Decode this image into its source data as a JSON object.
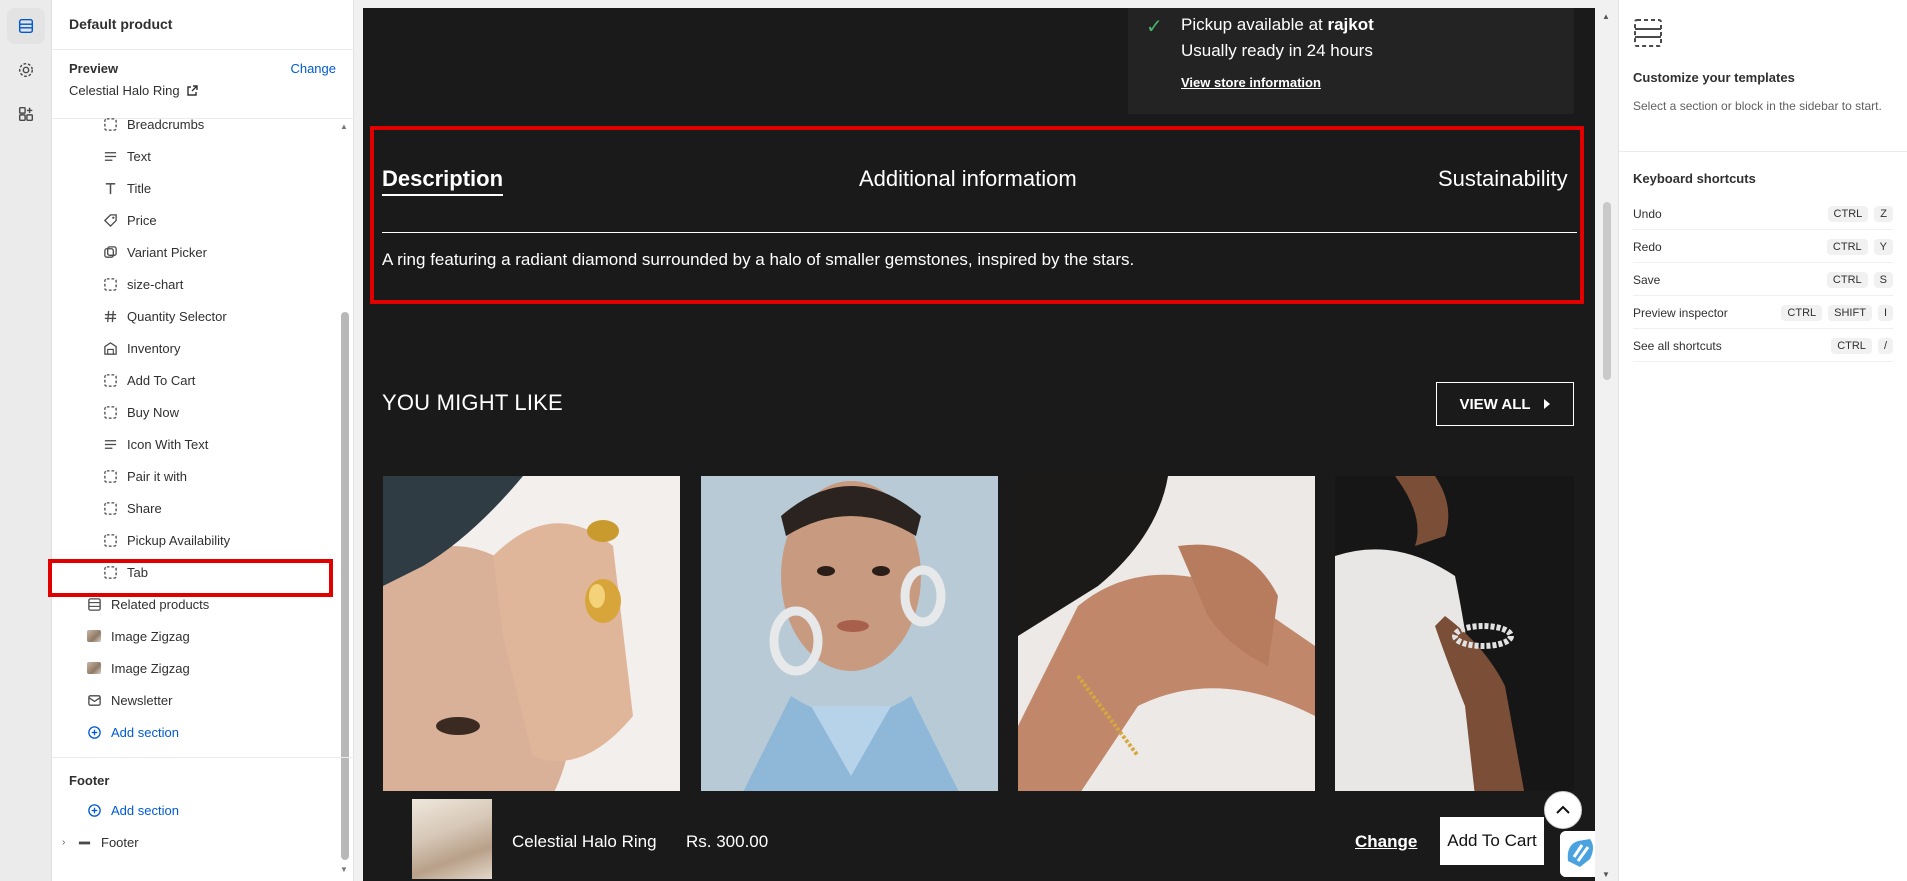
{
  "sidebar": {
    "title": "Default product",
    "preview_label": "Preview",
    "preview_change": "Change",
    "preview_product": "Celestial Halo Ring",
    "items": [
      {
        "label": "Breadcrumbs",
        "icon": "dashed-block-icon"
      },
      {
        "label": "Text",
        "icon": "text-lines-icon"
      },
      {
        "label": "Title",
        "icon": "title-t-icon"
      },
      {
        "label": "Price",
        "icon": "price-tag-icon"
      },
      {
        "label": "Variant Picker",
        "icon": "variant-picker-icon"
      },
      {
        "label": "size-chart",
        "icon": "dashed-block-icon"
      },
      {
        "label": "Quantity Selector",
        "icon": "hash-icon"
      },
      {
        "label": "Inventory",
        "icon": "inventory-icon"
      },
      {
        "label": "Add To Cart",
        "icon": "dashed-block-icon"
      },
      {
        "label": "Buy Now",
        "icon": "dashed-block-icon"
      },
      {
        "label": "Icon With Text",
        "icon": "text-lines-icon"
      },
      {
        "label": "Pair it with",
        "icon": "dashed-block-icon"
      },
      {
        "label": "Share",
        "icon": "dashed-block-icon"
      },
      {
        "label": "Pickup Availability",
        "icon": "dashed-block-icon"
      },
      {
        "label": "Tab",
        "icon": "dashed-block-icon"
      }
    ],
    "sections": [
      {
        "label": "Related products",
        "icon": "section-icon"
      },
      {
        "label": "Image Zigzag",
        "icon": "image-thumb-icon"
      },
      {
        "label": "Image Zigzag",
        "icon": "image-thumb-icon"
      },
      {
        "label": "Newsletter",
        "icon": "newsletter-icon"
      }
    ],
    "add_section": "Add section",
    "footer_label": "Footer",
    "footer_add_section": "Add section",
    "footer_item": "Footer"
  },
  "preview": {
    "pickup_text": "Pickup available at ",
    "pickup_location": "rajkot",
    "pickup_ready": "Usually ready in 24 hours",
    "pickup_link": "View store information",
    "tabs": [
      "Description",
      "Additional informatiom",
      "Sustainability"
    ],
    "tab_body": "A ring featuring a radiant diamond surrounded by a halo of smaller gemstones, inspired by the stars.",
    "you_might_like": "YOU MIGHT LIKE",
    "view_all": "VIEW ALL",
    "sticky_name": "Celestial Halo Ring",
    "sticky_price": "Rs. 300.00",
    "sticky_change": "Change",
    "sticky_add": "Add To Cart"
  },
  "right_panel": {
    "title": "Customize your templates",
    "description": "Select a section or block in the sidebar to start.",
    "shortcuts_title": "Keyboard shortcuts",
    "shortcuts": [
      {
        "label": "Undo",
        "keys": [
          "CTRL",
          "Z"
        ]
      },
      {
        "label": "Redo",
        "keys": [
          "CTRL",
          "Y"
        ]
      },
      {
        "label": "Save",
        "keys": [
          "CTRL",
          "S"
        ]
      },
      {
        "label": "Preview inspector",
        "keys": [
          "CTRL",
          "SHIFT",
          "I"
        ]
      },
      {
        "label": "See all shortcuts",
        "keys": [
          "CTRL",
          "/"
        ]
      }
    ]
  },
  "colors": {
    "accent": "#005bd3",
    "highlight": "#e00000",
    "canvas_bg": "#1a1a1a",
    "pickup_check": "#49b36b"
  }
}
